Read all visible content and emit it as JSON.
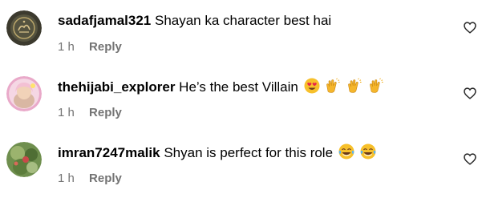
{
  "comments": [
    {
      "username": "sadafjamal321",
      "text": "Shayan ka character best hai",
      "time": "1 h",
      "reply_label": "Reply",
      "emojis": []
    },
    {
      "username": "thehijabi_explorer",
      "text": "He’s the best Villain",
      "time": "1 h",
      "reply_label": "Reply",
      "emojis": [
        "heart-eyes-emoji",
        "clapping-hands-emoji",
        "clapping-hands-emoji",
        "clapping-hands-emoji"
      ]
    },
    {
      "username": "imran7247malik",
      "text": "Shyan is perfect for this role",
      "time": "1 h",
      "reply_label": "Reply",
      "emojis": [
        "tears-of-joy-emoji",
        "tears-of-joy-emoji"
      ]
    }
  ],
  "colors": {
    "username": "#000000",
    "meta": "#737373",
    "emoji_yellow": "#f7c02b"
  },
  "icons": {
    "like": "heart-outline-icon"
  }
}
